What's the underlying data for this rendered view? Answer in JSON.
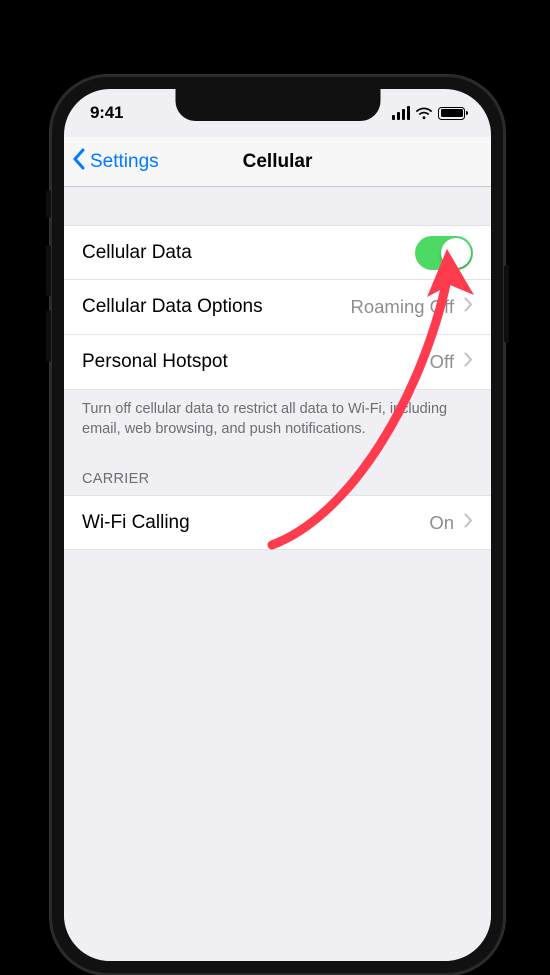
{
  "status": {
    "time": "9:41"
  },
  "nav": {
    "back_label": "Settings",
    "title": "Cellular"
  },
  "rows": {
    "cellular_data": {
      "label": "Cellular Data"
    },
    "cellular_data_options": {
      "label": "Cellular Data Options",
      "value": "Roaming Off"
    },
    "personal_hotspot": {
      "label": "Personal Hotspot",
      "value": "Off"
    },
    "wifi_calling": {
      "label": "Wi-Fi Calling",
      "value": "On"
    }
  },
  "footer_note": "Turn off cellular data to restrict all data to Wi-Fi, including email, web browsing, and push notifications.",
  "section_carrier": "CARRIER",
  "colors": {
    "tint": "#007aff",
    "toggle_on": "#4cd964",
    "arrow": "#ff3b4e"
  }
}
